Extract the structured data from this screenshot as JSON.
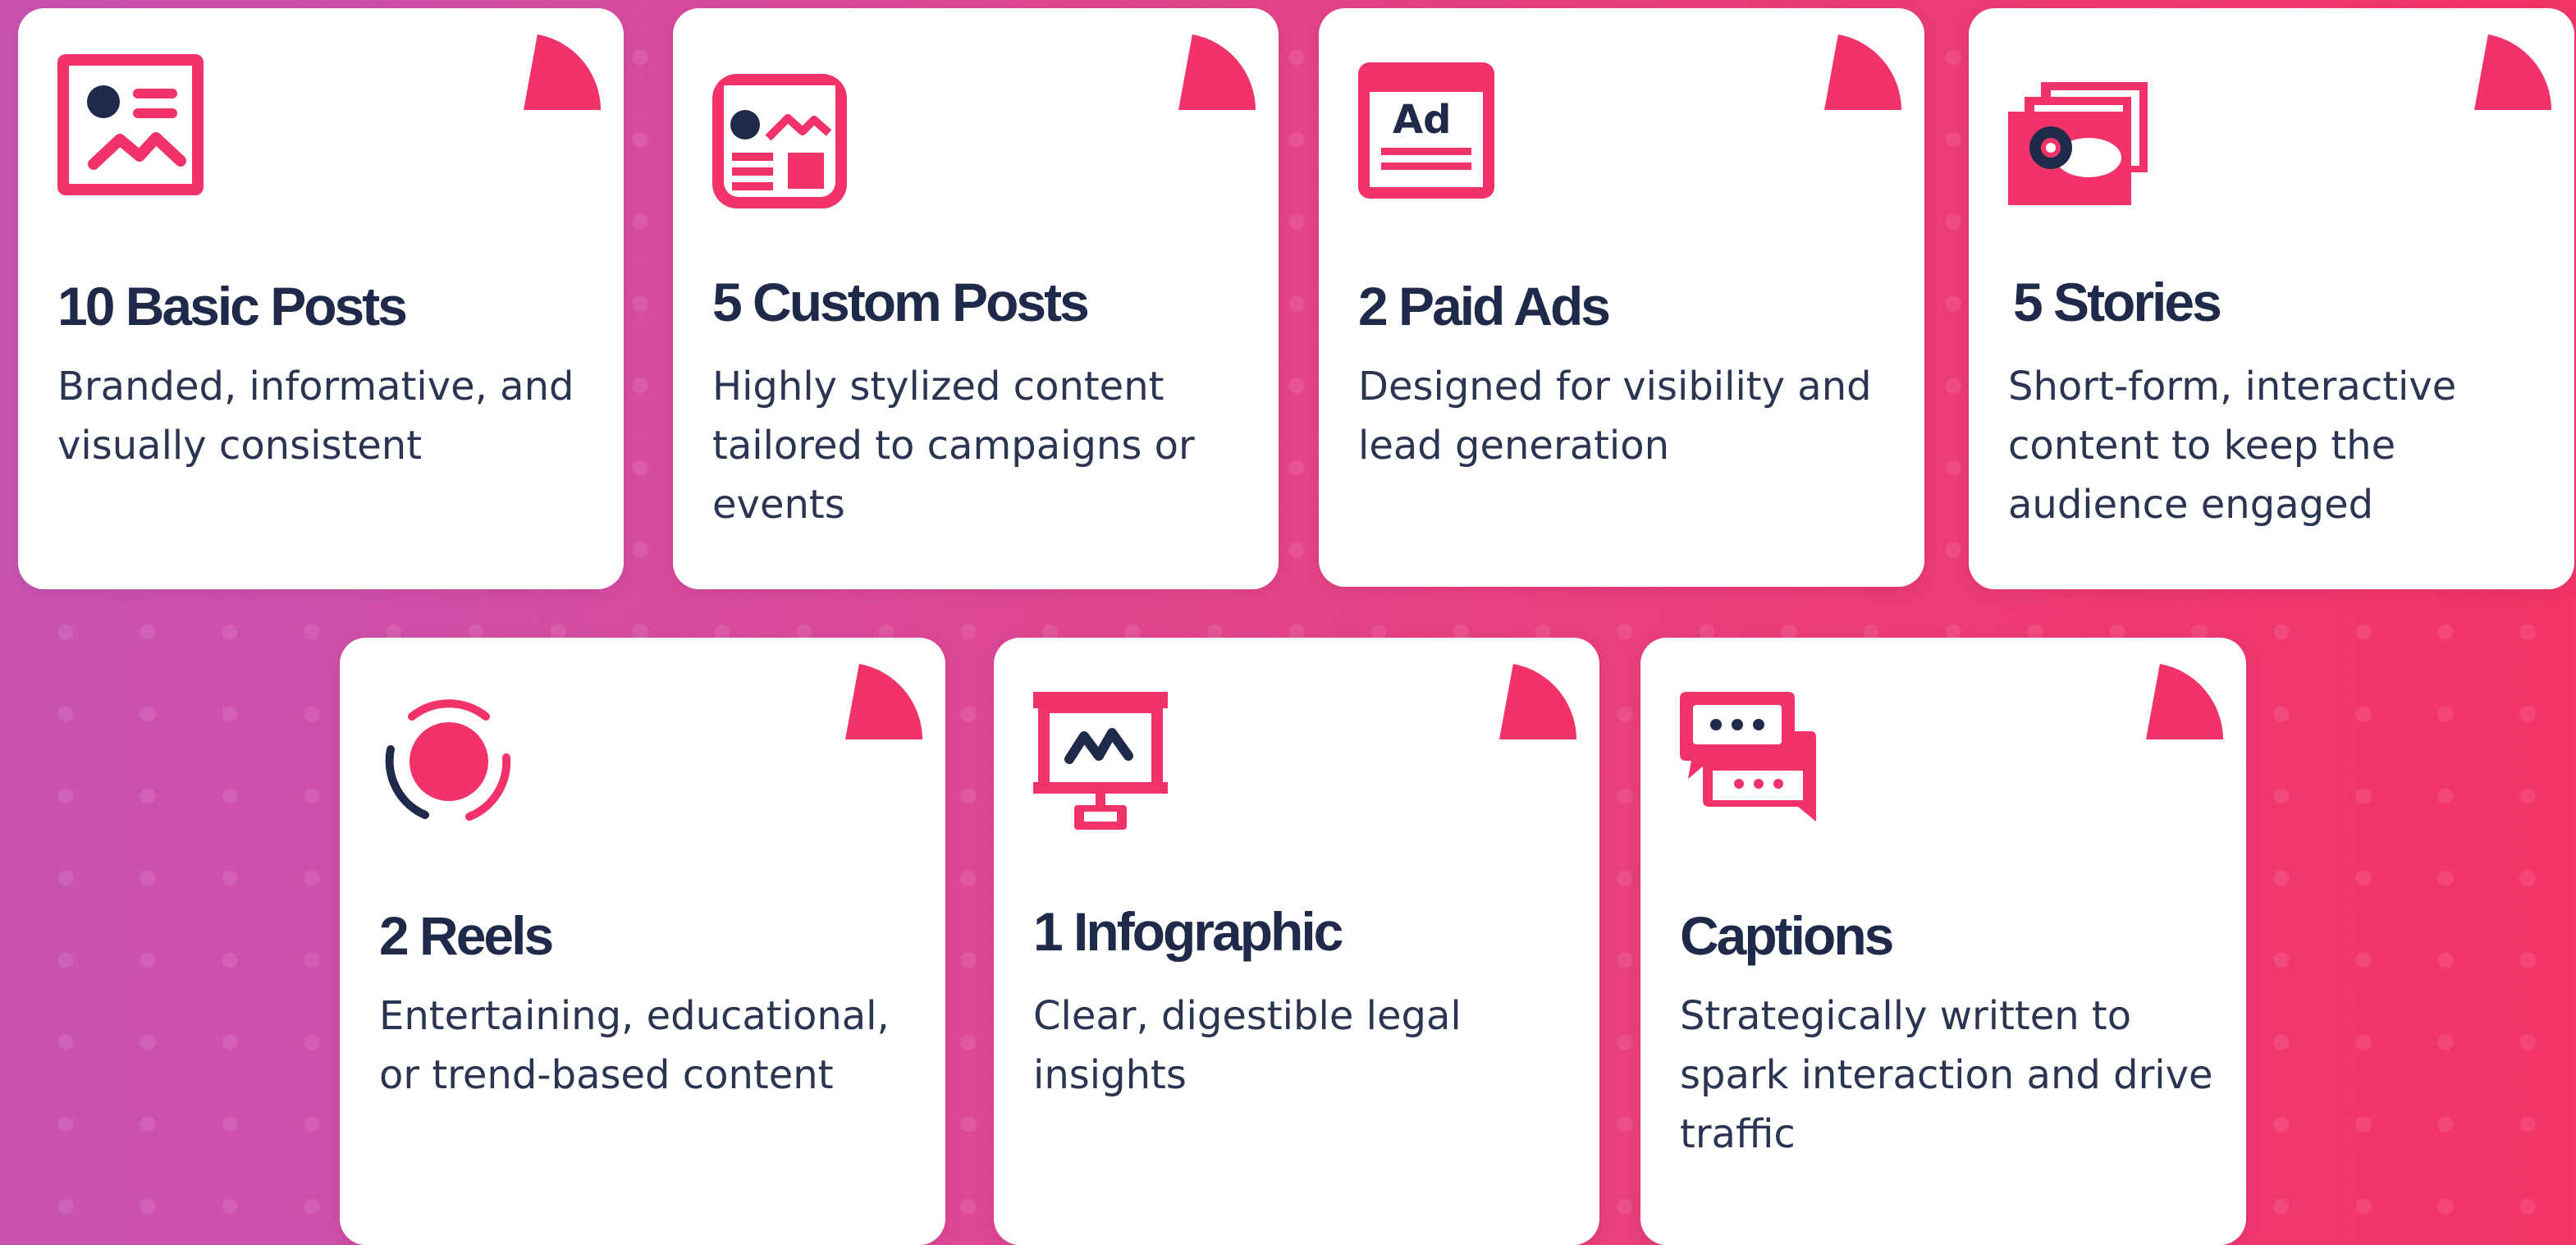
{
  "colors": {
    "accent": "#f2336a",
    "navy": "#1f2a4a",
    "card": "#ffffff"
  },
  "cards": [
    {
      "title": "10 Basic Posts",
      "description": "Branded, informative, and visually consistent",
      "icon": "image-post-icon"
    },
    {
      "title": "5 Custom Posts",
      "description": "Highly stylized content tailored to campaigns or events",
      "icon": "custom-layout-icon"
    },
    {
      "title": "2 Paid Ads",
      "description": "Designed for visibility and lead generation",
      "icon": "ad-icon"
    },
    {
      "title": "5 Stories",
      "description": "Short-form, interactive content to keep the audience engaged",
      "icon": "stories-icon"
    },
    {
      "title": "2 Reels",
      "description": "Entertaining, educational, or trend-based content",
      "icon": "record-icon"
    },
    {
      "title": "1 Infographic",
      "description": "Clear, digestible legal insights",
      "icon": "presentation-icon"
    },
    {
      "title": "Captions",
      "description": "Strategically written to spark interaction and drive traffic",
      "icon": "chat-bubbles-icon"
    }
  ]
}
